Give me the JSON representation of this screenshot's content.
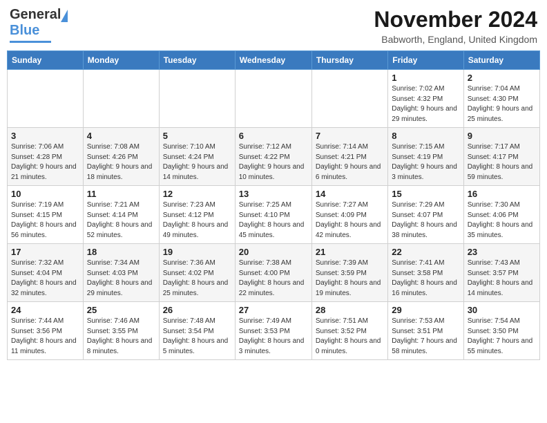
{
  "header": {
    "logo_word1": "General",
    "logo_word2": "Blue",
    "month_title": "November 2024",
    "location": "Babworth, England, United Kingdom"
  },
  "weekdays": [
    "Sunday",
    "Monday",
    "Tuesday",
    "Wednesday",
    "Thursday",
    "Friday",
    "Saturday"
  ],
  "weeks": [
    [
      {
        "day": "",
        "info": ""
      },
      {
        "day": "",
        "info": ""
      },
      {
        "day": "",
        "info": ""
      },
      {
        "day": "",
        "info": ""
      },
      {
        "day": "",
        "info": ""
      },
      {
        "day": "1",
        "info": "Sunrise: 7:02 AM\nSunset: 4:32 PM\nDaylight: 9 hours and 29 minutes."
      },
      {
        "day": "2",
        "info": "Sunrise: 7:04 AM\nSunset: 4:30 PM\nDaylight: 9 hours and 25 minutes."
      }
    ],
    [
      {
        "day": "3",
        "info": "Sunrise: 7:06 AM\nSunset: 4:28 PM\nDaylight: 9 hours and 21 minutes."
      },
      {
        "day": "4",
        "info": "Sunrise: 7:08 AM\nSunset: 4:26 PM\nDaylight: 9 hours and 18 minutes."
      },
      {
        "day": "5",
        "info": "Sunrise: 7:10 AM\nSunset: 4:24 PM\nDaylight: 9 hours and 14 minutes."
      },
      {
        "day": "6",
        "info": "Sunrise: 7:12 AM\nSunset: 4:22 PM\nDaylight: 9 hours and 10 minutes."
      },
      {
        "day": "7",
        "info": "Sunrise: 7:14 AM\nSunset: 4:21 PM\nDaylight: 9 hours and 6 minutes."
      },
      {
        "day": "8",
        "info": "Sunrise: 7:15 AM\nSunset: 4:19 PM\nDaylight: 9 hours and 3 minutes."
      },
      {
        "day": "9",
        "info": "Sunrise: 7:17 AM\nSunset: 4:17 PM\nDaylight: 8 hours and 59 minutes."
      }
    ],
    [
      {
        "day": "10",
        "info": "Sunrise: 7:19 AM\nSunset: 4:15 PM\nDaylight: 8 hours and 56 minutes."
      },
      {
        "day": "11",
        "info": "Sunrise: 7:21 AM\nSunset: 4:14 PM\nDaylight: 8 hours and 52 minutes."
      },
      {
        "day": "12",
        "info": "Sunrise: 7:23 AM\nSunset: 4:12 PM\nDaylight: 8 hours and 49 minutes."
      },
      {
        "day": "13",
        "info": "Sunrise: 7:25 AM\nSunset: 4:10 PM\nDaylight: 8 hours and 45 minutes."
      },
      {
        "day": "14",
        "info": "Sunrise: 7:27 AM\nSunset: 4:09 PM\nDaylight: 8 hours and 42 minutes."
      },
      {
        "day": "15",
        "info": "Sunrise: 7:29 AM\nSunset: 4:07 PM\nDaylight: 8 hours and 38 minutes."
      },
      {
        "day": "16",
        "info": "Sunrise: 7:30 AM\nSunset: 4:06 PM\nDaylight: 8 hours and 35 minutes."
      }
    ],
    [
      {
        "day": "17",
        "info": "Sunrise: 7:32 AM\nSunset: 4:04 PM\nDaylight: 8 hours and 32 minutes."
      },
      {
        "day": "18",
        "info": "Sunrise: 7:34 AM\nSunset: 4:03 PM\nDaylight: 8 hours and 29 minutes."
      },
      {
        "day": "19",
        "info": "Sunrise: 7:36 AM\nSunset: 4:02 PM\nDaylight: 8 hours and 25 minutes."
      },
      {
        "day": "20",
        "info": "Sunrise: 7:38 AM\nSunset: 4:00 PM\nDaylight: 8 hours and 22 minutes."
      },
      {
        "day": "21",
        "info": "Sunrise: 7:39 AM\nSunset: 3:59 PM\nDaylight: 8 hours and 19 minutes."
      },
      {
        "day": "22",
        "info": "Sunrise: 7:41 AM\nSunset: 3:58 PM\nDaylight: 8 hours and 16 minutes."
      },
      {
        "day": "23",
        "info": "Sunrise: 7:43 AM\nSunset: 3:57 PM\nDaylight: 8 hours and 14 minutes."
      }
    ],
    [
      {
        "day": "24",
        "info": "Sunrise: 7:44 AM\nSunset: 3:56 PM\nDaylight: 8 hours and 11 minutes."
      },
      {
        "day": "25",
        "info": "Sunrise: 7:46 AM\nSunset: 3:55 PM\nDaylight: 8 hours and 8 minutes."
      },
      {
        "day": "26",
        "info": "Sunrise: 7:48 AM\nSunset: 3:54 PM\nDaylight: 8 hours and 5 minutes."
      },
      {
        "day": "27",
        "info": "Sunrise: 7:49 AM\nSunset: 3:53 PM\nDaylight: 8 hours and 3 minutes."
      },
      {
        "day": "28",
        "info": "Sunrise: 7:51 AM\nSunset: 3:52 PM\nDaylight: 8 hours and 0 minutes."
      },
      {
        "day": "29",
        "info": "Sunrise: 7:53 AM\nSunset: 3:51 PM\nDaylight: 7 hours and 58 minutes."
      },
      {
        "day": "30",
        "info": "Sunrise: 7:54 AM\nSunset: 3:50 PM\nDaylight: 7 hours and 55 minutes."
      }
    ]
  ]
}
